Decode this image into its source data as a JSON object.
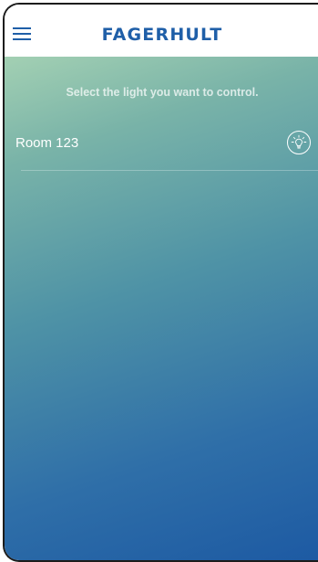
{
  "header": {
    "brand": "FAGERHULT",
    "menu_icon": "hamburger-menu-icon"
  },
  "main": {
    "instruction": "Select the light you want to control.",
    "lights": [
      {
        "name": "Room 123",
        "icon": "light-bulb-icon"
      }
    ]
  },
  "colors": {
    "brand": "#1f5fa8",
    "gradient_top": "#a3d0b3",
    "gradient_bottom": "#1d5aa3"
  }
}
